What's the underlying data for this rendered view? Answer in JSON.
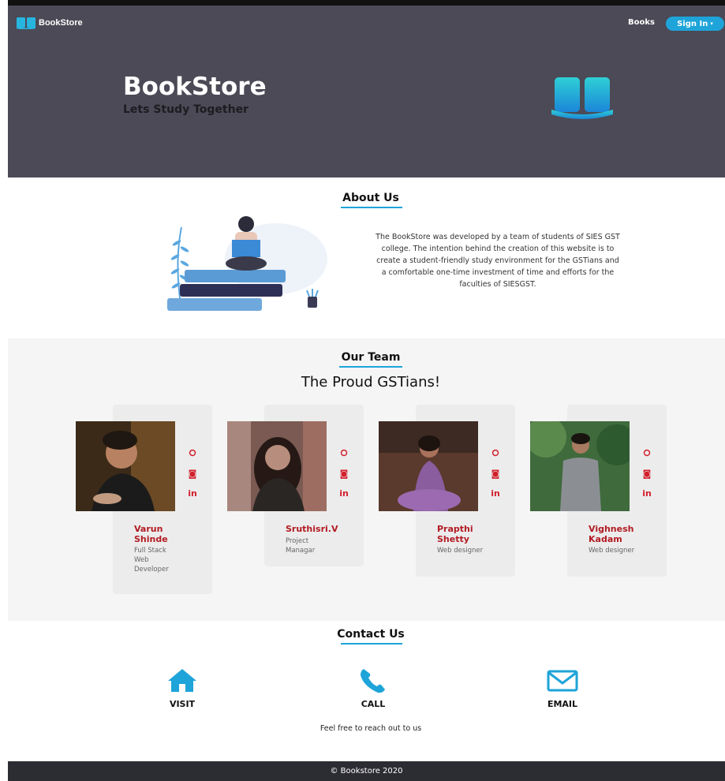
{
  "navbar": {
    "brand": "BookStore",
    "books_link": "Books",
    "signin_button": "Sign In",
    "signin_caret": "▾"
  },
  "hero": {
    "title": "BookStore",
    "tagline": "Lets Study Together"
  },
  "about": {
    "heading": "About Us",
    "body": "The BookStore was developed by a team of students of SIES GST college. The intention behind the creation of this website is to create a student-friendly study environment for the GSTians and a comfortable one-time investment of time and efforts for the faculties of SIESGST."
  },
  "team": {
    "heading": "Our Team",
    "subheading": "The Proud GSTians!",
    "social_icons": [
      "github-icon",
      "instagram-icon",
      "linkedin-icon"
    ],
    "linkedin_glyph": "in",
    "members": [
      {
        "name": "Varun Shinde",
        "role": "Full Stack Web Developer"
      },
      {
        "name": "Sruthisri.V",
        "role": "Project Managar"
      },
      {
        "name": "Prapthi Shetty",
        "role": "Web designer"
      },
      {
        "name": "Vighnesh Kadam",
        "role": "Web designer"
      }
    ]
  },
  "contact": {
    "heading": "Contact Us",
    "items": [
      {
        "icon": "home-icon",
        "label": "VISIT"
      },
      {
        "icon": "phone-icon",
        "label": "CALL"
      },
      {
        "icon": "envelope-icon",
        "label": "EMAIL"
      }
    ],
    "note": "Feel free to reach out to us"
  },
  "footer": {
    "text": "© Bookstore 2020"
  },
  "colors": {
    "hero_bg": "#4b4a56",
    "accent": "#1ea4d9",
    "name_red": "#b21b23",
    "footer_bg": "#2c2c33"
  }
}
